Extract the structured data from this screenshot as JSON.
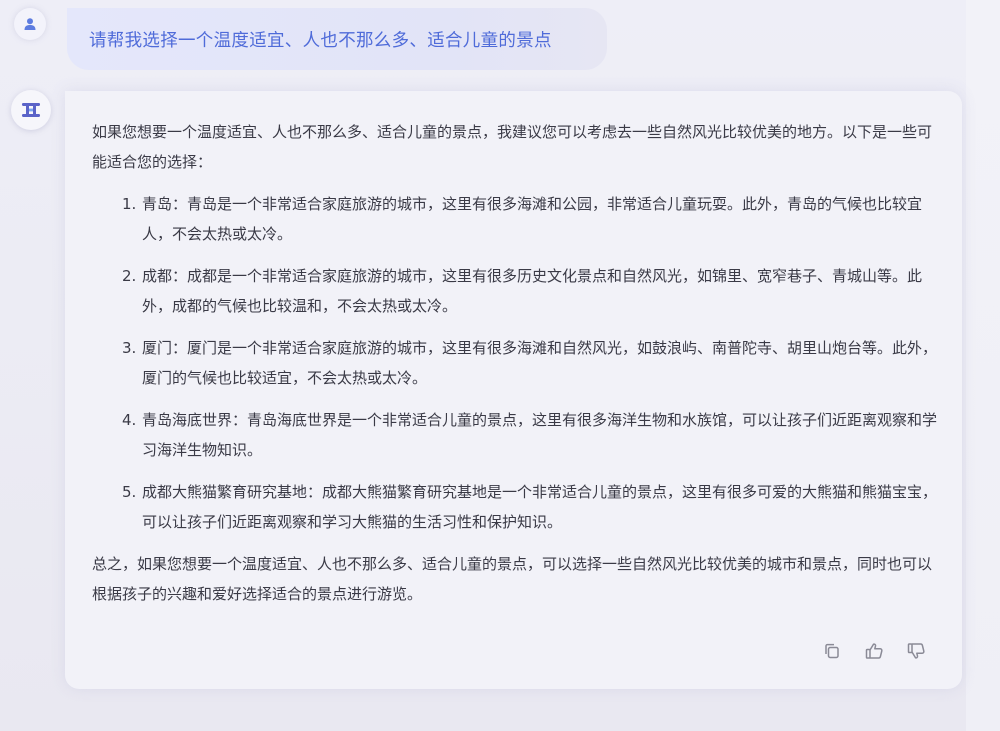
{
  "conversation": {
    "user_message": "请帮我选择一个温度适宜、人也不那么多、适合儿童的景点",
    "answer": {
      "intro": "如果您想要一个温度适宜、人也不那么多、适合儿童的景点，我建议您可以考虑去一些自然风光比较优美的地方。以下是一些可能适合您的选择：",
      "items": [
        {
          "num": "1.",
          "text": "青岛：青岛是一个非常适合家庭旅游的城市，这里有很多海滩和公园，非常适合儿童玩耍。此外，青岛的气候也比较宜人，不会太热或太冷。"
        },
        {
          "num": "2.",
          "text": "成都：成都是一个非常适合家庭旅游的城市，这里有很多历史文化景点和自然风光，如锦里、宽窄巷子、青城山等。此外，成都的气候也比较温和，不会太热或太冷。"
        },
        {
          "num": "3.",
          "text": "厦门：厦门是一个非常适合家庭旅游的城市，这里有很多海滩和自然风光，如鼓浪屿、南普陀寺、胡里山炮台等。此外，厦门的气候也比较适宜，不会太热或太冷。"
        },
        {
          "num": "4.",
          "text": "青岛海底世界：青岛海底世界是一个非常适合儿童的景点，这里有很多海洋生物和水族馆，可以让孩子们近距离观察和学习海洋生物知识。"
        },
        {
          "num": "5.",
          "text": "成都大熊猫繁育研究基地：成都大熊猫繁育研究基地是一个非常适合儿童的景点，这里有很多可爱的大熊猫和熊猫宝宝，可以让孩子们近距离观察和学习大熊猫的生活习性和保护知识。"
        }
      ],
      "summary": "总之，如果您想要一个温度适宜、人也不那么多、适合儿童的景点，可以选择一些自然风光比较优美的城市和景点，同时也可以根据孩子的兴趣和爱好选择适合的景点进行游览。"
    },
    "actions": [
      {
        "icon": "copy-icon"
      },
      {
        "icon": "thumbs-up-icon"
      },
      {
        "icon": "thumbs-down-icon"
      }
    ]
  },
  "colors": {
    "user_text": "#4f6bd9",
    "answer_text": "#3a3a46",
    "icon": "#8a8a96",
    "bot_logo": "#5a63c8"
  }
}
